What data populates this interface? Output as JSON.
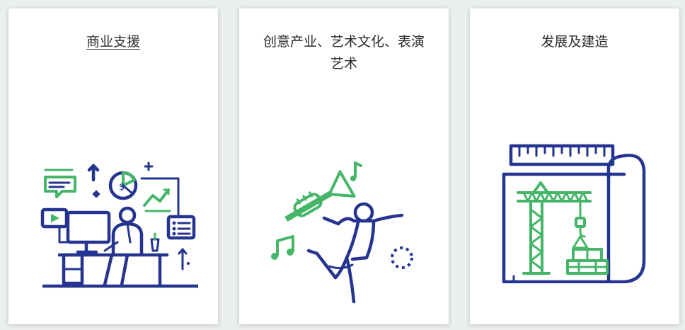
{
  "cards": [
    {
      "title": "商业支援",
      "icon": "business-desk-icon"
    },
    {
      "title": "创意产业、艺术文化、表演艺术",
      "icon": "dancer-music-icon"
    },
    {
      "title": "发展及建造",
      "icon": "construction-blueprint-icon"
    }
  ],
  "colors": {
    "primary_blue": "#25358f",
    "accent_green": "#45b568",
    "background": "#eceff0",
    "card": "#ffffff"
  }
}
